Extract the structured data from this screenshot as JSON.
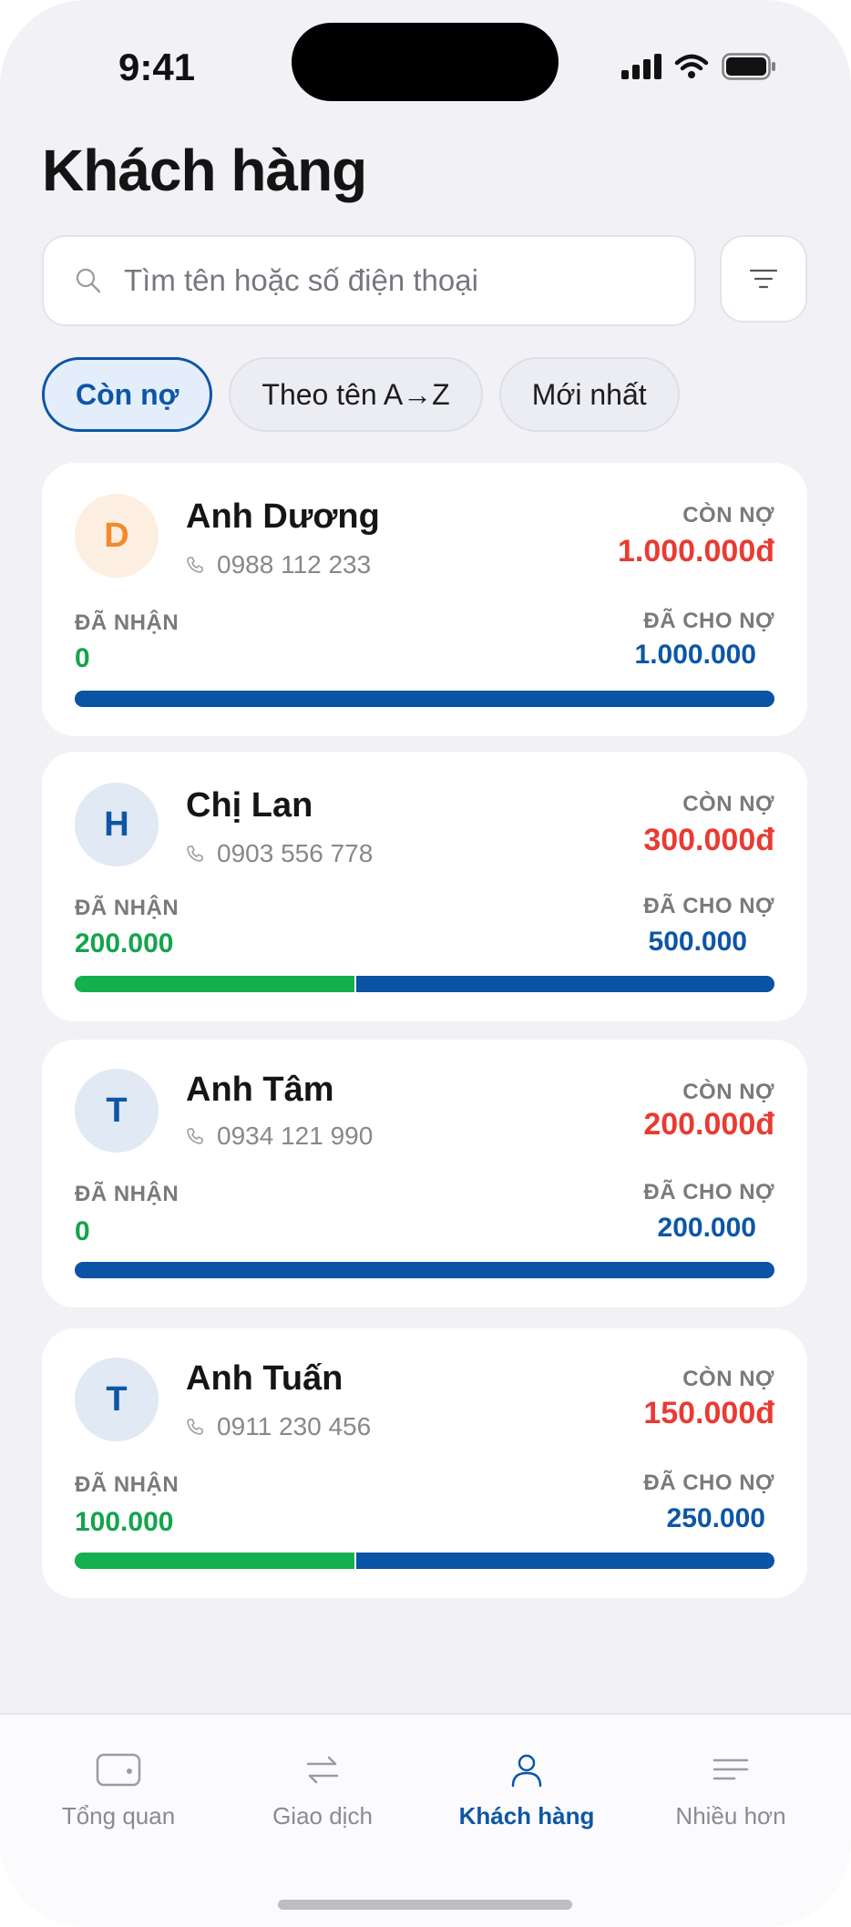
{
  "status": {
    "time": "9:41"
  },
  "page": {
    "title": "Khách hàng"
  },
  "search": {
    "placeholder": "Tìm tên hoặc số điện thoại",
    "icon": "search-icon"
  },
  "filter": {
    "icon": "filter-icon"
  },
  "chips": [
    {
      "label": "Còn nợ",
      "active": true
    },
    {
      "label": "Theo tên A→Z",
      "active": false
    },
    {
      "label": "Mới nhất",
      "active": false
    }
  ],
  "labels": {
    "debt": "CÒN NỢ",
    "received": "ĐÃ NHẬN",
    "lent": "ĐÃ CHO NỢ"
  },
  "customers": [
    {
      "initial": "D",
      "name": "Anh Dương",
      "phone": "0988 112 233",
      "debt": "1.000.000đ",
      "received": "0",
      "lent": "1.000.000",
      "received_fraction": 0,
      "avatar_bg": "#fdeee2",
      "avatar_fg": "#f08a2c"
    },
    {
      "initial": "H",
      "name": "Chị Lan",
      "phone": "0903 556 778",
      "debt": "300.000đ",
      "received": "200.000",
      "lent": "500.000",
      "received_fraction": 0.4,
      "avatar_bg": "#e0e9f4",
      "avatar_fg": "#0d56a6"
    },
    {
      "initial": "T",
      "name": "Anh Tâm",
      "phone": "0934 121 990",
      "debt": "200.000đ",
      "received": "0",
      "lent": "200.000",
      "received_fraction": 0,
      "avatar_bg": "#e0e9f4",
      "avatar_fg": "#0d56a6"
    },
    {
      "initial": "T",
      "name": "Anh Tuấn",
      "phone": "0911 230 456",
      "debt": "150.000đ",
      "received": "100.000",
      "lent": "250.000",
      "received_fraction": 0.4,
      "avatar_bg": "#e0e9f4",
      "avatar_fg": "#0d56a6"
    }
  ],
  "tabs": [
    {
      "label": "Tổng quan",
      "icon": "wallet-icon",
      "active": false
    },
    {
      "label": "Giao dịch",
      "icon": "transfer-icon",
      "active": false
    },
    {
      "label": "Khách hàng",
      "icon": "user-icon",
      "active": true
    },
    {
      "label": "Nhiều hơn",
      "icon": "menu-icon",
      "active": false
    }
  ],
  "colors": {
    "primary": "#0d56a6",
    "debt": "#e83b33",
    "received": "#14a44d"
  }
}
